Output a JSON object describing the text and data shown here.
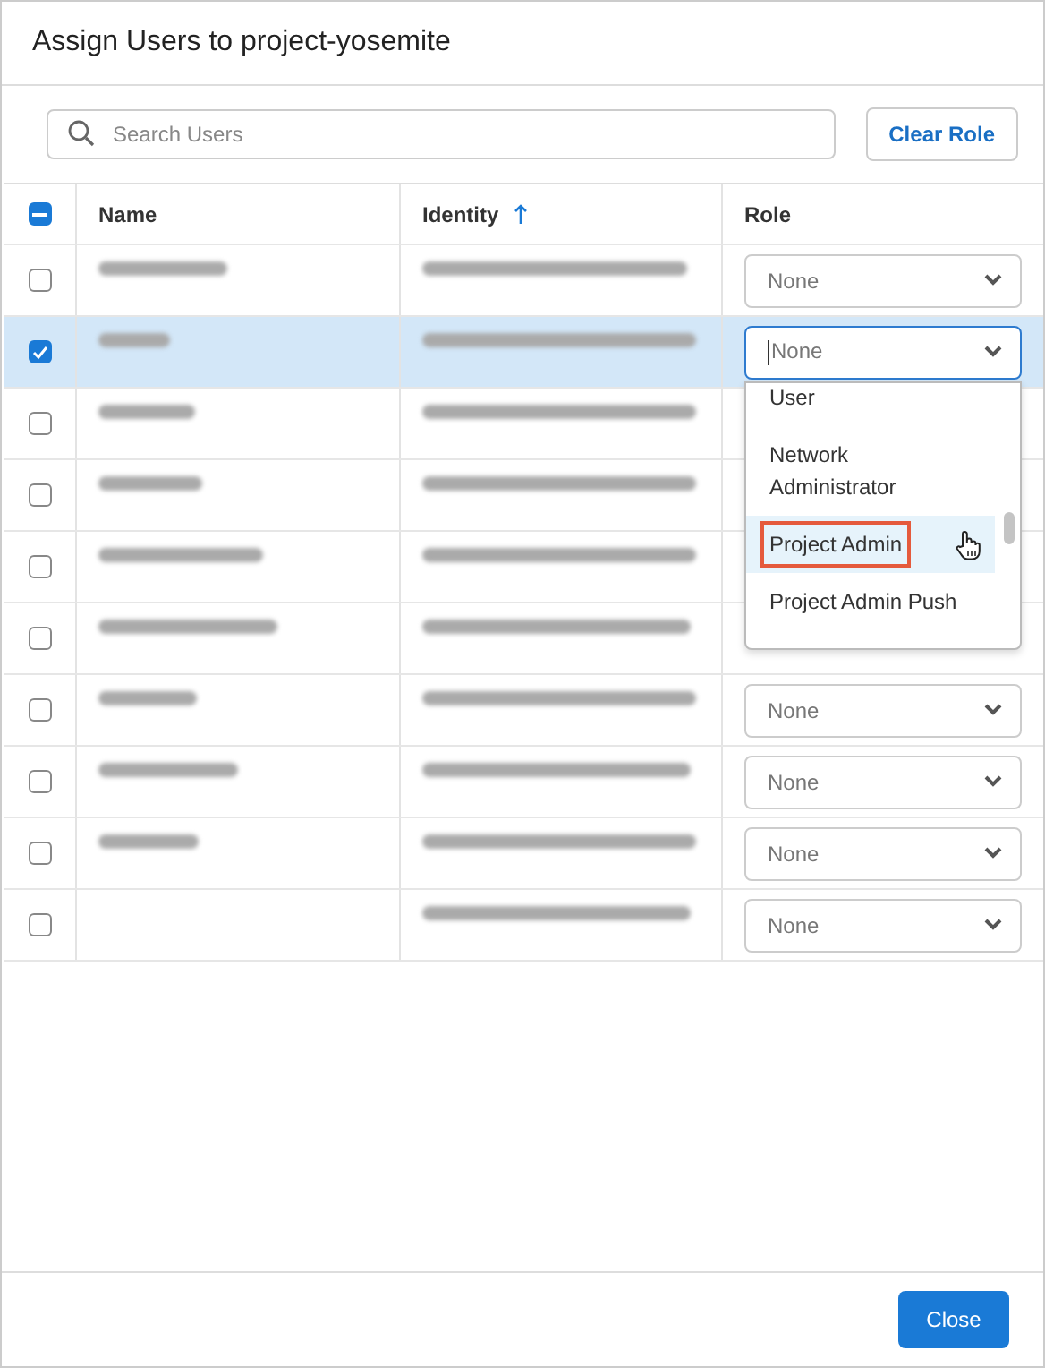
{
  "dialog": {
    "title": "Assign Users to project-yosemite"
  },
  "search": {
    "placeholder": "Search Users"
  },
  "clear_role_button": {
    "label": "Clear Role"
  },
  "table": {
    "select_all": {
      "indeterminate": true
    },
    "columns": [
      {
        "label": "Name",
        "sort_ascending": false
      },
      {
        "label": "Identity",
        "sort_ascending": true
      },
      {
        "label": "Role",
        "sort_ascending": false
      }
    ],
    "rows": [
      {
        "checked": false,
        "name_blurred": true,
        "identity_blurred": true,
        "role": "None",
        "menu_open": false
      },
      {
        "checked": true,
        "name_blurred": true,
        "identity_blurred": true,
        "role": "None",
        "menu_open": true
      },
      {
        "checked": false,
        "name_blurred": true,
        "identity_blurred": true,
        "menu_open": false
      },
      {
        "checked": false,
        "name_blurred": true,
        "identity_blurred": true,
        "menu_open": false
      },
      {
        "checked": false,
        "name_blurred": true,
        "identity_blurred": true,
        "menu_open": false
      },
      {
        "checked": false,
        "name_blurred": true,
        "identity_blurred": true,
        "menu_open": false
      },
      {
        "checked": false,
        "name_blurred": true,
        "identity_blurred": true,
        "role": "None",
        "menu_open": false
      },
      {
        "checked": false,
        "name_blurred": true,
        "identity_blurred": true,
        "role": "None",
        "menu_open": false
      },
      {
        "checked": false,
        "name_blurred": true,
        "identity_blurred": true,
        "role": "None",
        "menu_open": false
      },
      {
        "checked": false,
        "name_blurred": false,
        "identity_blurred": true,
        "role": "None",
        "menu_open": false
      }
    ]
  },
  "role_menu": {
    "options": [
      {
        "label": "User",
        "selected": false,
        "outlined": false
      },
      {
        "label": "Network Administrator",
        "selected": false,
        "outlined": false
      },
      {
        "label": "Project Admin",
        "selected": true,
        "outlined": true
      },
      {
        "label": "Project Admin Push",
        "selected": false,
        "outlined": false
      }
    ]
  },
  "footer": {
    "close_button": {
      "label": "Close"
    }
  }
}
